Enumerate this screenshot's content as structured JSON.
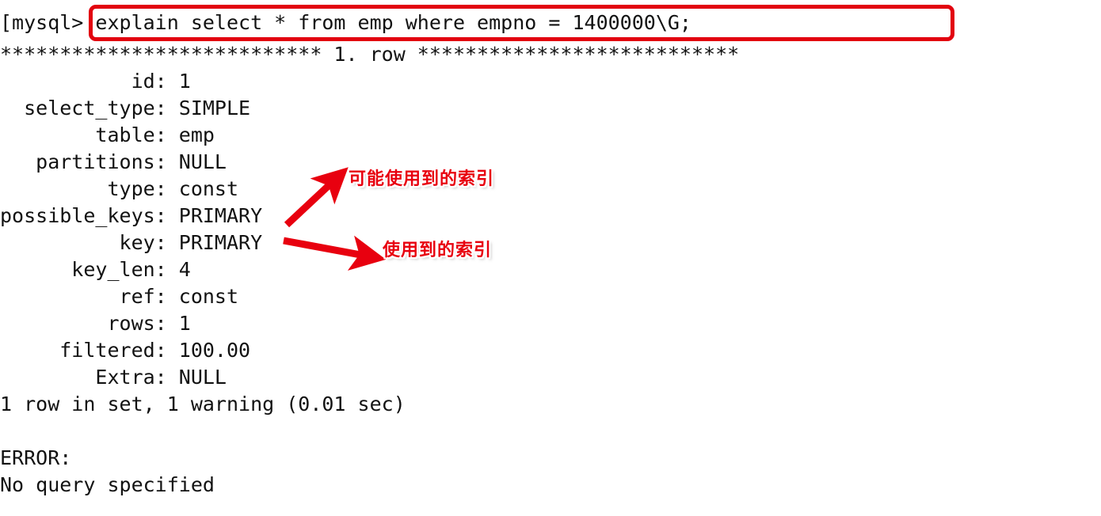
{
  "terminal": {
    "prompt": "[mysql> ",
    "command": "explain select * from emp where empno = 1400000\\G;",
    "prompt_line": "[mysql> explain select * from emp where empno = 1400000\\G;",
    "row_separator": "*************************** 1. row ***************************",
    "explain_rows": [
      {
        "field": "id",
        "value": "1",
        "line": "           id: 1"
      },
      {
        "field": "select_type",
        "value": "SIMPLE",
        "line": "  select_type: SIMPLE"
      },
      {
        "field": "table",
        "value": "emp",
        "line": "        table: emp"
      },
      {
        "field": "partitions",
        "value": "NULL",
        "line": "   partitions: NULL"
      },
      {
        "field": "type",
        "value": "const",
        "line": "         type: const"
      },
      {
        "field": "possible_keys",
        "value": "PRIMARY",
        "line": "possible_keys: PRIMARY"
      },
      {
        "field": "key",
        "value": "PRIMARY",
        "line": "          key: PRIMARY"
      },
      {
        "field": "key_len",
        "value": "4",
        "line": "      key_len: 4"
      },
      {
        "field": "ref",
        "value": "const",
        "line": "          ref: const"
      },
      {
        "field": "rows",
        "value": "1",
        "line": "         rows: 1"
      },
      {
        "field": "filtered",
        "value": "100.00",
        "line": "     filtered: 100.00"
      },
      {
        "field": "Extra",
        "value": "NULL",
        "line": "        Extra: NULL"
      }
    ],
    "result_summary": "1 row in set, 1 warning (0.01 sec)",
    "blank_line": "",
    "error_label": "ERROR:",
    "error_message": "No query specified"
  },
  "annotations": {
    "possible_keys_note": "可能使用到的索引",
    "key_note": "使用到的索引",
    "color": "#e8000f",
    "box_color": "#e2000f"
  }
}
